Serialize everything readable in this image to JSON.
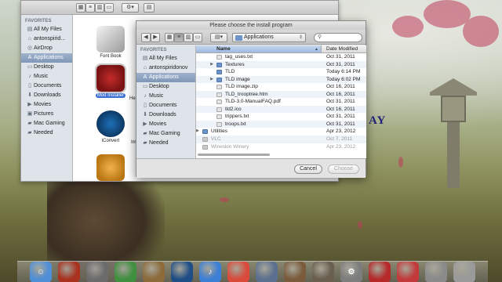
{
  "colors": {
    "selection": "#3b6ed1",
    "sidebar_bg": "#dee4ea",
    "folder_blue": "#6e93c8"
  },
  "desktop": {
    "overlay_text": "AY"
  },
  "finder_back": {
    "sidebar": {
      "heading": "FAVORITES",
      "items": [
        {
          "label": "All My Files",
          "icon": "all-files-icon"
        },
        {
          "label": "antonspirid...",
          "icon": "home-icon"
        },
        {
          "label": "AirDrop",
          "icon": "airdrop-icon"
        },
        {
          "label": "Applications",
          "icon": "applications-icon",
          "selected": true
        },
        {
          "label": "Desktop",
          "icon": "desktop-icon"
        },
        {
          "label": "Music",
          "icon": "music-icon"
        },
        {
          "label": "Documents",
          "icon": "documents-icon"
        },
        {
          "label": "Downloads",
          "icon": "downloads-icon"
        },
        {
          "label": "Movies",
          "icon": "movies-icon"
        },
        {
          "label": "Pictures",
          "icon": "pictures-icon"
        },
        {
          "label": "Mac Gaming",
          "icon": "folder-icon"
        },
        {
          "label": "Needed",
          "icon": "folder-icon"
        }
      ]
    },
    "apps": [
      {
        "label": "Font Book",
        "icon": "font-book-icon"
      },
      {
        "label": "Mod Installer",
        "icon": "wineskin-icon",
        "selected": true
      },
      {
        "label": "iConvert",
        "icon": "iconvert-icon"
      },
      {
        "label": "",
        "icon": "installer-icon"
      }
    ],
    "cut_labels": [
      "Hea",
      "Im"
    ]
  },
  "dialog": {
    "title": "Please choose the install program",
    "path": "Applications",
    "search_placeholder": "",
    "sidebar": {
      "heading": "FAVORITES",
      "items": [
        {
          "label": "All My Files",
          "icon": "all-files-icon"
        },
        {
          "label": "antonspiridonov",
          "icon": "home-icon"
        },
        {
          "label": "Applications",
          "icon": "applications-icon",
          "selected": true
        },
        {
          "label": "Desktop",
          "icon": "desktop-icon"
        },
        {
          "label": "Music",
          "icon": "music-icon"
        },
        {
          "label": "Documents",
          "icon": "documents-icon"
        },
        {
          "label": "Downloads",
          "icon": "downloads-icon"
        },
        {
          "label": "Movies",
          "icon": "movies-icon"
        },
        {
          "label": "Mac Gaming",
          "icon": "folder-icon"
        },
        {
          "label": "Needed",
          "icon": "folder-icon"
        }
      ]
    },
    "columns": {
      "name": "Name",
      "date": "Date Modified"
    },
    "rows": [
      {
        "name": "tag_uses.txt",
        "date": "Oct 31, 2011",
        "kind": "file",
        "level": 2
      },
      {
        "name": "Textures",
        "date": "Oct 31, 2011",
        "kind": "folder",
        "level": 2,
        "disclosure": true
      },
      {
        "name": "TLD",
        "date": "Today 6:14 PM",
        "kind": "folder",
        "level": 2
      },
      {
        "name": "TLD image",
        "date": "Today 6:02 PM",
        "kind": "folder",
        "level": 2,
        "disclosure": true
      },
      {
        "name": "TLD image.zip",
        "date": "Oct 16, 2011",
        "kind": "file",
        "level": 2
      },
      {
        "name": "TLD_trooptree.htm",
        "date": "Oct 16, 2011",
        "kind": "file",
        "level": 2
      },
      {
        "name": "TLD-3.0-ManualFAQ.pdf",
        "date": "Oct 31, 2011",
        "kind": "file",
        "level": 2
      },
      {
        "name": "tld2.ico",
        "date": "Oct 16, 2011",
        "kind": "file",
        "level": 2
      },
      {
        "name": "trippers.txt",
        "date": "Oct 31, 2011",
        "kind": "file",
        "level": 2
      },
      {
        "name": "troops.txt",
        "date": "Oct 31, 2011",
        "kind": "file",
        "level": 2
      },
      {
        "name": "Utilities",
        "date": "Apr 23, 2012",
        "kind": "folder",
        "level": 0,
        "disclosure": true
      },
      {
        "name": "VLC",
        "date": "Oct 7, 2011",
        "kind": "app",
        "level": 0
      },
      {
        "name": "Wineskin Winery",
        "date": "Apr 23, 2012",
        "kind": "app",
        "level": 0
      }
    ],
    "buttons": {
      "cancel": "Cancel",
      "choose": "Choose"
    }
  },
  "dock": {
    "items": [
      {
        "name": "finder",
        "glyph": "☺",
        "color": "#4f8fd8"
      },
      {
        "name": "photo-app",
        "glyph": "",
        "color": "#a8321e"
      },
      {
        "name": "film-app",
        "glyph": "",
        "color": "#6b6b6b"
      },
      {
        "name": "time-app",
        "glyph": "",
        "color": "#3f8f3f"
      },
      {
        "name": "final-cut",
        "glyph": "",
        "color": "#8c6a3a"
      },
      {
        "name": "steam",
        "glyph": "",
        "color": "#1f4e86"
      },
      {
        "name": "itunes",
        "glyph": "♪",
        "color": "#3c7fd6"
      },
      {
        "name": "chrome",
        "glyph": "",
        "color": "#d94a3a"
      },
      {
        "name": "quicktime",
        "glyph": "",
        "color": "#5b6f8f"
      },
      {
        "name": "preview",
        "glyph": "",
        "color": "#7a5b3b"
      },
      {
        "name": "photos-stack",
        "glyph": "",
        "color": "#6a5e4e"
      },
      {
        "name": "system-preferences",
        "glyph": "⚙",
        "color": "#7d7d7d"
      },
      {
        "name": "wineskin-red",
        "glyph": "",
        "color": "#b52929"
      },
      {
        "name": "mod-installer",
        "glyph": "",
        "color": "#c33a3a"
      },
      {
        "name": "app-15",
        "glyph": "",
        "color": "#8a8a8a"
      },
      {
        "name": "trash",
        "glyph": "",
        "color": "#9a9a9a"
      }
    ]
  }
}
